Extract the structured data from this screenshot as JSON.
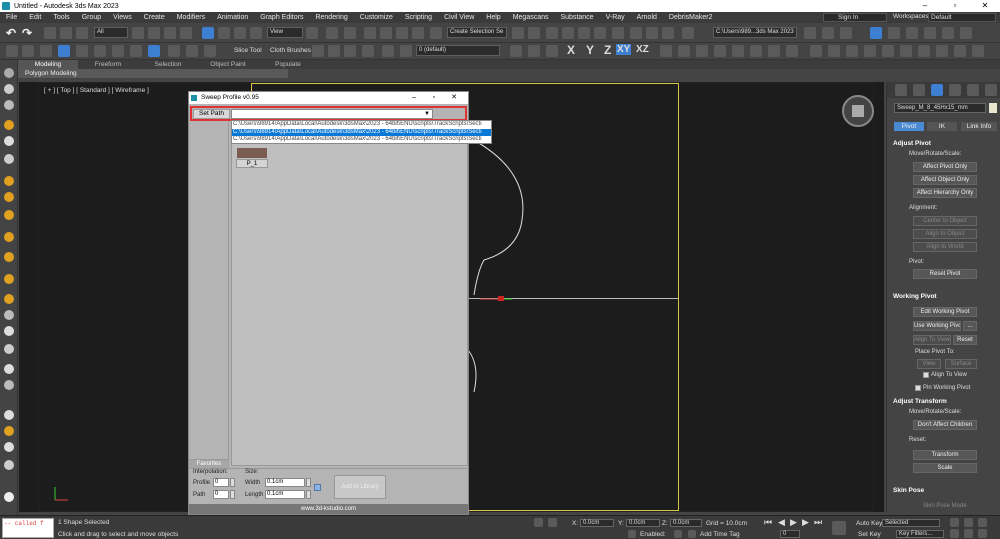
{
  "titlebar": {
    "title": "Untitled - Autodesk 3ds Max 2023"
  },
  "menu": [
    "File",
    "Edit",
    "Tools",
    "Group",
    "Views",
    "Create",
    "Modifiers",
    "Animation",
    "Graph Editors",
    "Rendering",
    "Customize",
    "Scripting",
    "Civil View",
    "Help",
    "Megascans",
    "Substance",
    "V-Ray",
    "Arnold",
    "DebrisMaker2"
  ],
  "signin": "Sign In",
  "workspaces_label": "Workspaces:",
  "workspace": "Default",
  "toolbar": {
    "filter": "All",
    "view": "View",
    "sel_set": "Create Selection Se",
    "path": "C:\\Users\\989...3ds Max 2023",
    "layer": "0 (default)",
    "slice_tool": "Slice Tool",
    "cloth_brushes": "Cloth Brushes",
    "axes": [
      "X",
      "Y",
      "Z",
      "XY",
      "XZ"
    ]
  },
  "ribbon": {
    "tabs": [
      "Modeling",
      "Freeform",
      "Selection",
      "Object Paint",
      "Populate"
    ],
    "sub": "Polygon Modeling"
  },
  "viewport": {
    "label": "[ + ] [ Top ] [ Standard ] [ Wireframe ]"
  },
  "dialog": {
    "title": "Sweep Profile v0.95",
    "set_path": "Set Path",
    "options": [
      "C:\\Users\\98914\\AppData\\Local\\Autodesk\\3dsMax\\2023 - 64bit\\ENU\\scripts\\TrackScripts\\Secti",
      "C:\\Users\\98914\\AppData\\Local\\Autodesk\\3dsMax\\2023 - 64bit\\ENU\\scripts\\TrackScripts\\Secti",
      "C:\\Users\\98914\\AppData\\Local\\Autodesk\\3dsMax\\2023 - 64bit\\ENU\\scripts\\TrackScripts\\Secti"
    ],
    "thumb_label": "P_1",
    "favorites": "Favorites",
    "interp_label": "Interpolation:",
    "size_label": "Size:",
    "profile_label": "Profile",
    "profile_val": "0",
    "path_label": "Path",
    "path_val": "0",
    "width_label": "Width",
    "width_val": "0.1cm",
    "length_label": "Length",
    "length_val": "0.1cm",
    "add_library": "Add to Library",
    "footer": "www.3d-kstudio.com"
  },
  "cmd": {
    "object_name": "Sweep_M_8_45Hx15_mm",
    "tabs": [
      "Pivot",
      "IK",
      "Link Info"
    ],
    "adjust_pivot": "Adjust Pivot",
    "move_rotate_scale": "Move/Rotate/Scale:",
    "affect_pivot": "Affect Pivot Only",
    "affect_object": "Affect Object Only",
    "affect_hierarchy": "Affect Hierarchy Only",
    "alignment": "Alignment:",
    "center_to_object": "Center to Object",
    "align_to_object": "Align to Object",
    "align_to_world": "Align to World",
    "pivot_label": "Pivot:",
    "reset_pivot": "Reset Pivot",
    "working_pivot": "Working Pivot",
    "edit_working_pivot": "Edit Working Pivot",
    "use_working_pivot": "Use Working Pivot",
    "dots": "...",
    "align_to_view_btn": "Align To View",
    "reset": "Reset",
    "place_pivot_to": "Place Pivot To:",
    "view": "View",
    "surface": "Surface",
    "align_to_view_chk": "Align To View",
    "pin_working_pivot": "Pin Working Pivot",
    "adjust_transform": "Adjust Transform",
    "move_rotate_scale2": "Move/Rotate/Scale:",
    "dont_affect_children": "Don't Affect Children",
    "reset_label": "Reset:",
    "transform": "Transform",
    "scale": "Scale",
    "skin_pose": "Skin Pose",
    "skin_pose_mode": "Skin Pose Mode"
  },
  "status": {
    "maxscript": "-- called f",
    "selected": "1 Shape Selected",
    "hint": "Click and drag to select and move objects",
    "x_label": "X:",
    "x_val": "0.0cm",
    "y_label": "Y:",
    "y_val": "0.0cm",
    "z_label": "Z:",
    "z_val": "0.0cm",
    "grid": "Grid = 10.0cm",
    "enabled": "Enabled:",
    "add_time_tag": "Add Time Tag",
    "auto_key": "Auto Key",
    "set_key": "Set Key",
    "selected_dd": "Selected",
    "key_filters": "Key Filters...",
    "frame": "0"
  }
}
